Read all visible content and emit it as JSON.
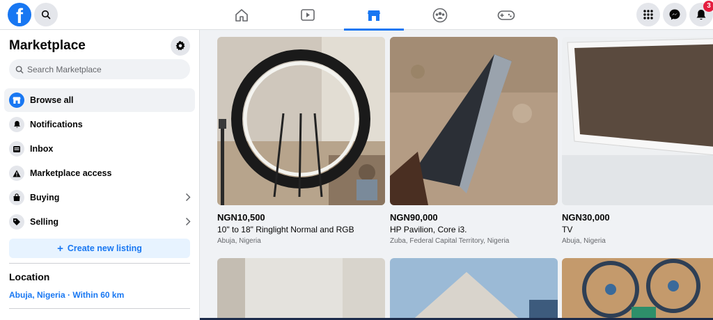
{
  "topbar": {
    "nav_tabs": [
      "home-icon",
      "watch-icon",
      "marketplace-icon",
      "groups-icon",
      "gaming-icon"
    ],
    "active_tab": "marketplace",
    "notification_count": "3",
    "brand_color": "#1877f2"
  },
  "sidebar": {
    "title": "Marketplace",
    "search_placeholder": "Search Marketplace",
    "items": [
      {
        "label": "Browse all",
        "icon": "storefront-icon"
      },
      {
        "label": "Notifications",
        "icon": "bell-icon"
      },
      {
        "label": "Inbox",
        "icon": "inbox-icon"
      },
      {
        "label": "Marketplace access",
        "icon": "warning-icon"
      },
      {
        "label": "Buying",
        "icon": "bag-icon"
      },
      {
        "label": "Selling",
        "icon": "tag-icon"
      }
    ],
    "create_label": "Create new listing",
    "location_heading": "Location",
    "location_value": "Abuja, Nigeria · Within 60 km"
  },
  "listings": [
    {
      "price": "NGN10,500",
      "title": "10\" to 18\" Ringlight Normal and RGB",
      "location": "Abuja, Nigeria"
    },
    {
      "price": "NGN90,000",
      "title": "HP Pavilion, Core i3.",
      "location": "Zuba, Federal Capital Territory, Nigeria"
    },
    {
      "price": "NGN30,000",
      "title": "TV",
      "location": "Abuja, Nigeria"
    }
  ]
}
